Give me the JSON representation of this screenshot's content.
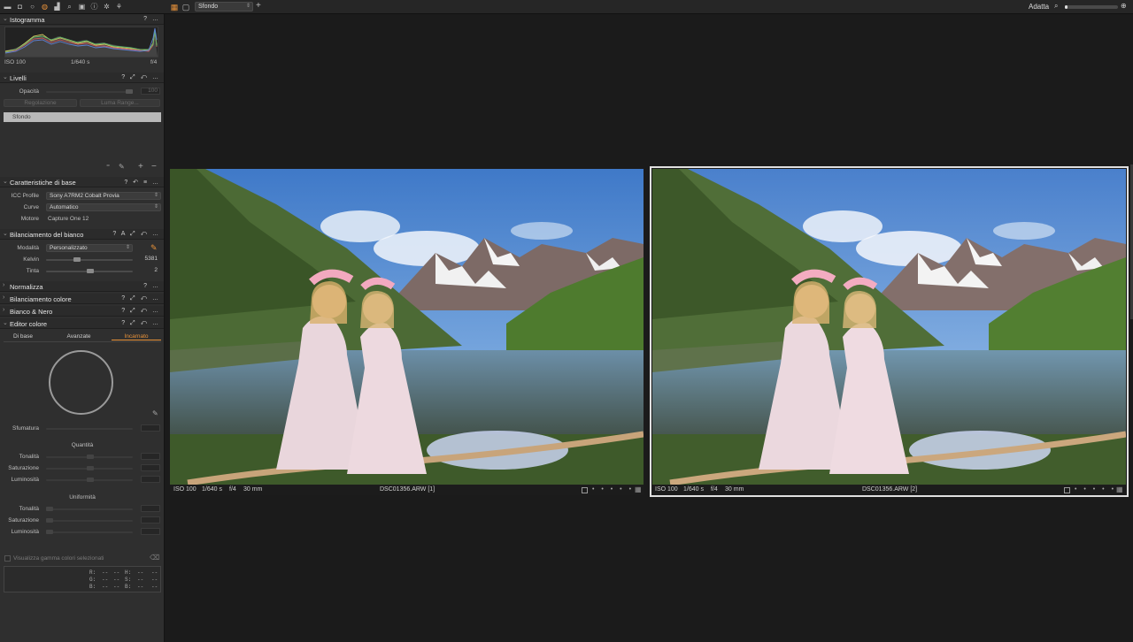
{
  "toolbar": {
    "tab_icons": [
      "library-icon",
      "capture-icon",
      "lens-icon",
      "color-icon",
      "exposure-icon",
      "details-icon",
      "adjustments-icon",
      "metadata-icon",
      "info-icon",
      "settings-icon",
      "styles-icon"
    ],
    "active_tab_icon": "color-icon",
    "variant_select": "Sfondo",
    "fit_label": "Adatta",
    "zoom_level": 0.05
  },
  "histogram": {
    "title": "Istogramma",
    "iso": "ISO 100",
    "shutter": "1/640 s",
    "aperture": "f/4"
  },
  "layers": {
    "title": "Livelli",
    "opacity_label": "Opacità",
    "opacity_value": "100",
    "adjust_button": "Regolazione",
    "luma_button": "Luma Range...",
    "layer_name": "Sfondo"
  },
  "base_characteristics": {
    "title": "Caratteristiche di base",
    "icc_label": "ICC Profile",
    "icc_value": "Sony A7RM2 Cobalt Provia",
    "curve_label": "Curve",
    "curve_value": "Automatico",
    "engine_label": "Motore",
    "engine_value": "Capture One 12"
  },
  "white_balance": {
    "title": "Bilanciamento del bianco",
    "mode_label": "Modalità",
    "mode_value": "Personalizzato",
    "kelvin_label": "Kelvin",
    "kelvin_value": "5381",
    "tint_label": "Tinta",
    "tint_value": "2"
  },
  "collapsed_tools": {
    "normalize": "Normalizza",
    "color_balance": "Bilanciamento colore",
    "black_white": "Bianco & Nero"
  },
  "color_editor": {
    "title": "Editor colore",
    "tabs": [
      "Di base",
      "Avanzate",
      "Incarnato"
    ],
    "smoothness_label": "Sfumatura",
    "amount_title": "Quantità",
    "hue_label": "Tonalità",
    "saturation_label": "Saturazione",
    "lightness_label": "Luminosità",
    "uniformity_title": "Uniformità",
    "view_gamut_label": "Visualizza gamma colori selezionati",
    "r_label": "R:",
    "g_label": "G:",
    "b_label": "B:",
    "h_label": "H:",
    "s_label": "S:",
    "b2_label": "B:",
    "dash": "--"
  },
  "viewer": {
    "photo1": {
      "iso": "ISO 100",
      "shutter": "1/640 s",
      "aperture": "f/4",
      "focal": "30 mm",
      "filename": "DSC01356.ARW [1]"
    },
    "photo2": {
      "iso": "ISO 100",
      "shutter": "1/640 s",
      "aperture": "f/4",
      "focal": "30 mm",
      "filename": "DSC01356.ARW [2]"
    },
    "rating_dots": "• • • • •"
  }
}
